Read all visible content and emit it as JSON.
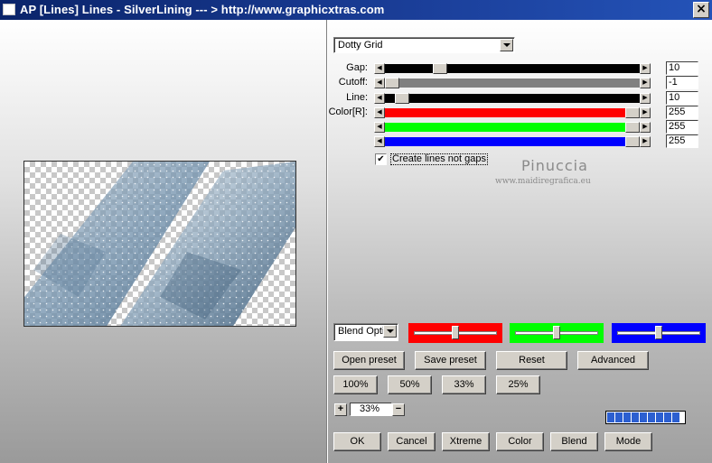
{
  "window": {
    "title": "AP [Lines]  Lines - SilverLining     --- > http://www.graphicxtras.com",
    "close_glyph": "×"
  },
  "effect": {
    "selected": "Dotty Grid"
  },
  "sliders": [
    {
      "label": "Gap:",
      "value": "10",
      "fraction": 0.2,
      "fill_color": "#000000",
      "thumb": true
    },
    {
      "label": "Cutoff:",
      "value": "-1",
      "fraction": 0.0,
      "fill_color": "#808080",
      "thumb": true
    },
    {
      "label": "Line:",
      "value": "10",
      "fraction": 0.04,
      "fill_color": "#000000",
      "thumb": true
    },
    {
      "label": "Color[R]:",
      "value": "255",
      "fraction": 1.0,
      "fill_color": "#ff0000",
      "thumb": true
    },
    {
      "label": "",
      "value": "255",
      "fraction": 1.0,
      "fill_color": "#00ff00",
      "thumb": true
    },
    {
      "label": "",
      "value": "255",
      "fraction": 1.0,
      "fill_color": "#0000ff",
      "thumb": true
    }
  ],
  "options": {
    "create_lines_label": "Create lines not gaps",
    "create_lines_checked": true,
    "check_glyph": "✔"
  },
  "watermark": {
    "name": "Pinuccia",
    "url": "www.maidiregrafica.eu"
  },
  "blend": {
    "selected": "Blend Options",
    "color_boxes": [
      {
        "color": "#ff0000",
        "level": 0.5
      },
      {
        "color": "#00ff00",
        "level": 0.5
      },
      {
        "color": "#0000ff",
        "level": 0.5
      }
    ]
  },
  "preset_buttons": [
    "Open preset",
    "Save preset",
    "Reset",
    "Advanced"
  ],
  "zoom_buttons": [
    "100%",
    "50%",
    "33%",
    "25%"
  ],
  "zoom": {
    "plus": "+",
    "minus": "−",
    "value": "33%"
  },
  "progress": {
    "segments": 9
  },
  "bottom_buttons": [
    "OK",
    "Cancel",
    "Xtreme",
    "Color",
    "Blend",
    "Mode"
  ]
}
